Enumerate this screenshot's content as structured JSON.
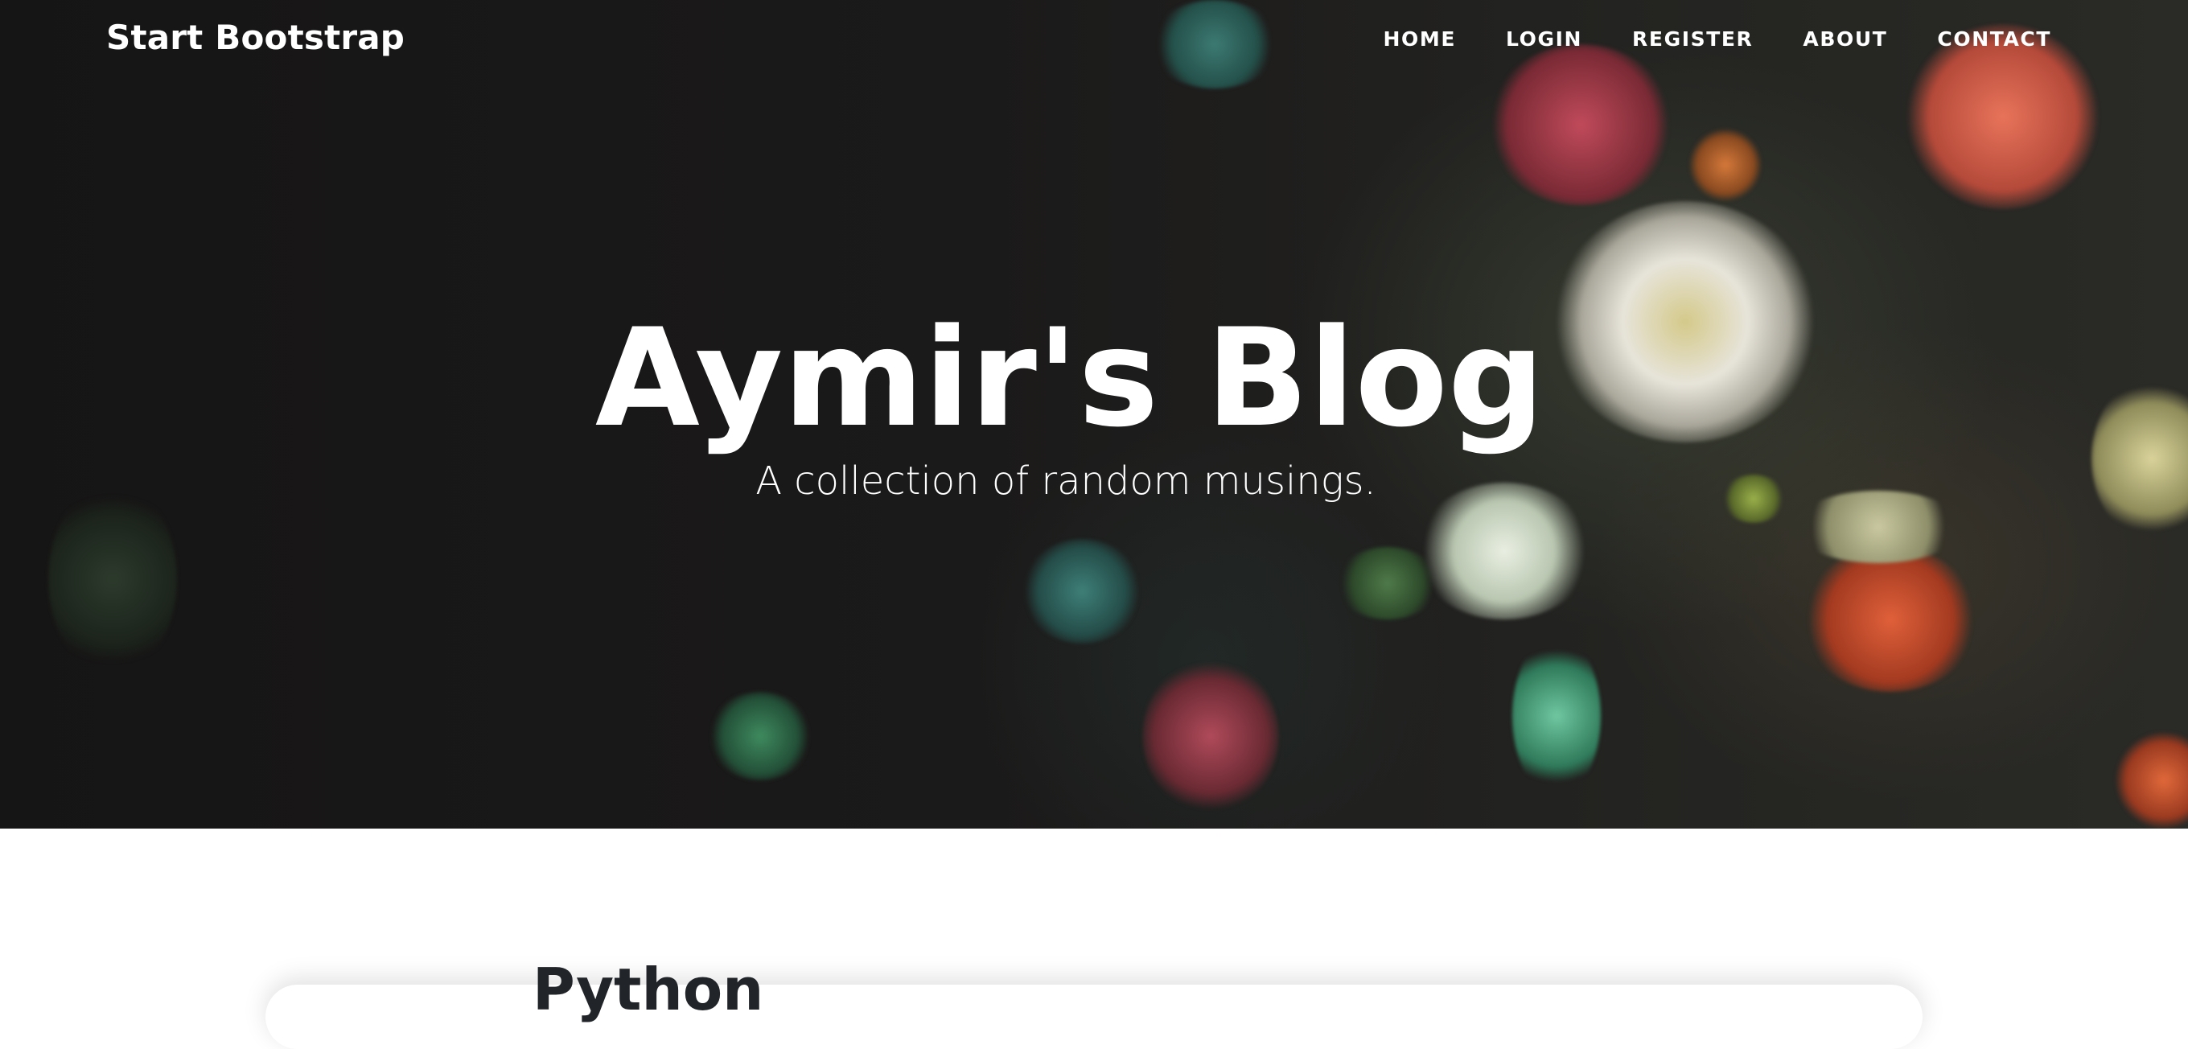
{
  "nav": {
    "brand": "Start Bootstrap",
    "links": [
      {
        "label": "HOME"
      },
      {
        "label": "LOGIN"
      },
      {
        "label": "REGISTER"
      },
      {
        "label": "ABOUT"
      },
      {
        "label": "CONTACT"
      }
    ]
  },
  "hero": {
    "title": "Aymir's Blog",
    "subtitle": "A collection of random musings."
  },
  "main": {
    "section_title": "Python"
  }
}
